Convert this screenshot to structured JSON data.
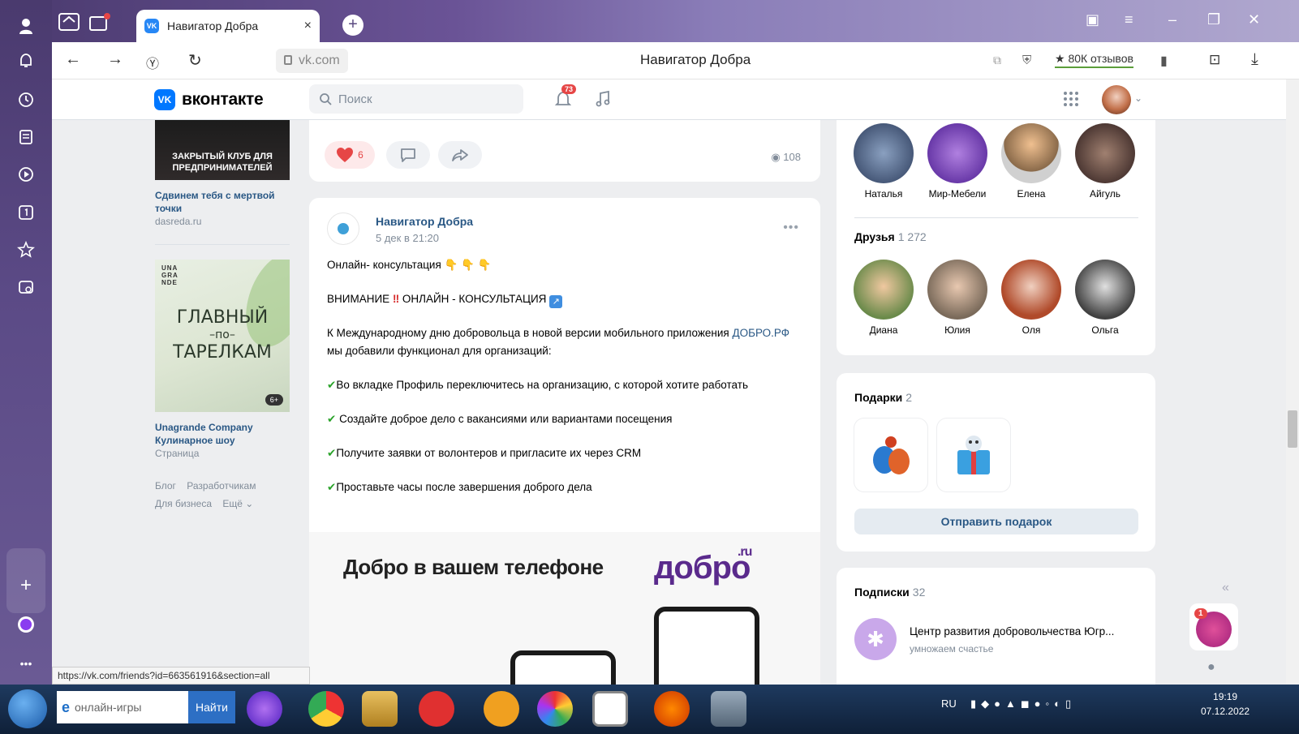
{
  "browser": {
    "tab_title": "Навигатор Добра",
    "tab_close": "×",
    "new_tab": "+",
    "url": "vk.com",
    "page_title": "Навигатор Добра",
    "reviews": "★ 80К отзывов",
    "status_url": "https://vk.com/friends?id=663561916&section=all"
  },
  "vk": {
    "logo_text": "вконтакте",
    "logo_mark": "VK",
    "search_placeholder": "Поиск",
    "notif_count": "73"
  },
  "left": {
    "ad1_image_text": "ЗАКРЫТЫЙ КЛУБ ДЛЯ ПРЕДПРИНИМАТЕЛЕЙ",
    "ad1_title": "Сдвинем тебя с мертвой точки",
    "ad1_source": "dasreda.ru",
    "ad2_brand": "UNA GRA NDE",
    "ad2_big1": "ГЛАВНЫЙ",
    "ad2_big2": "–по–",
    "ad2_big3": "ТАРЕЛКАМ",
    "ad2_age": "6+",
    "ad2_title": "Unagrande Company Кулинарное шоу",
    "ad2_sub": "Страница",
    "footer": [
      "Блог",
      "Разработчикам",
      "Для бизнеса",
      "Ещё ⌄"
    ]
  },
  "prev_post": {
    "likes": "6",
    "views": "108"
  },
  "post": {
    "author": "Навигатор Добра",
    "date": "5 дек в 21:20",
    "more": "•••",
    "line1": "Онлайн- консультация",
    "line2": "ВНИМАНИЕ",
    "line2b": "ОНЛАЙН - КОНСУЛЬТАЦИЯ",
    "para1a": "К Международному дню добровольца в новой версии мобильного приложения",
    "para1_link": "ДОБРО.РФ",
    "para1b": "мы добавили функционал для организаций:",
    "b1": "Во вкладке Профиль переключитесь на организацию, с которой хотите работать",
    "b2": "Создайте доброе дело с вакансиями или вариантами посещения",
    "b3": "Получите заявки от волонтеров и пригласите их через CRM",
    "b4": "Проставьте часы после завершения доброго дела",
    "promo_text": "Добро в вашем телефоне",
    "promo_brand": "добро",
    "promo_ru": ".ru"
  },
  "right": {
    "groups": [
      {
        "name": "Наталья",
        "color": "#3a5a7a"
      },
      {
        "name": "Мир-Мебели",
        "color": "#6b3fb0"
      },
      {
        "name": "Елена",
        "color": "#c8a070"
      },
      {
        "name": "Айгуль",
        "color": "#4a2a2a"
      }
    ],
    "friends_title": "Друзья",
    "friends_count": "1 272",
    "friends": [
      {
        "name": "Диана",
        "color": "#9a6a3a"
      },
      {
        "name": "Юлия",
        "color": "#b08a6a"
      },
      {
        "name": "Оля",
        "color": "#c26040"
      },
      {
        "name": "Ольга",
        "color": "#707070"
      }
    ],
    "gifts_title": "Подарки",
    "gifts_count": "2",
    "send_gift": "Отправить подарок",
    "subs_title": "Подписки",
    "subs_count": "32",
    "sub_name": "Центр развития добровольчества Югр...",
    "sub_desc": "умножаем счастье",
    "notif_badge": "1"
  },
  "taskbar": {
    "search_text": "онлайн-игры",
    "find_btn": "Найти",
    "lang": "RU",
    "time": "19:19",
    "date": "07.12.2022"
  },
  "colors": {
    "vk_blue": "#0077ff",
    "link": "#2a5885",
    "bg": "#edeef0",
    "like": "#e64646"
  }
}
